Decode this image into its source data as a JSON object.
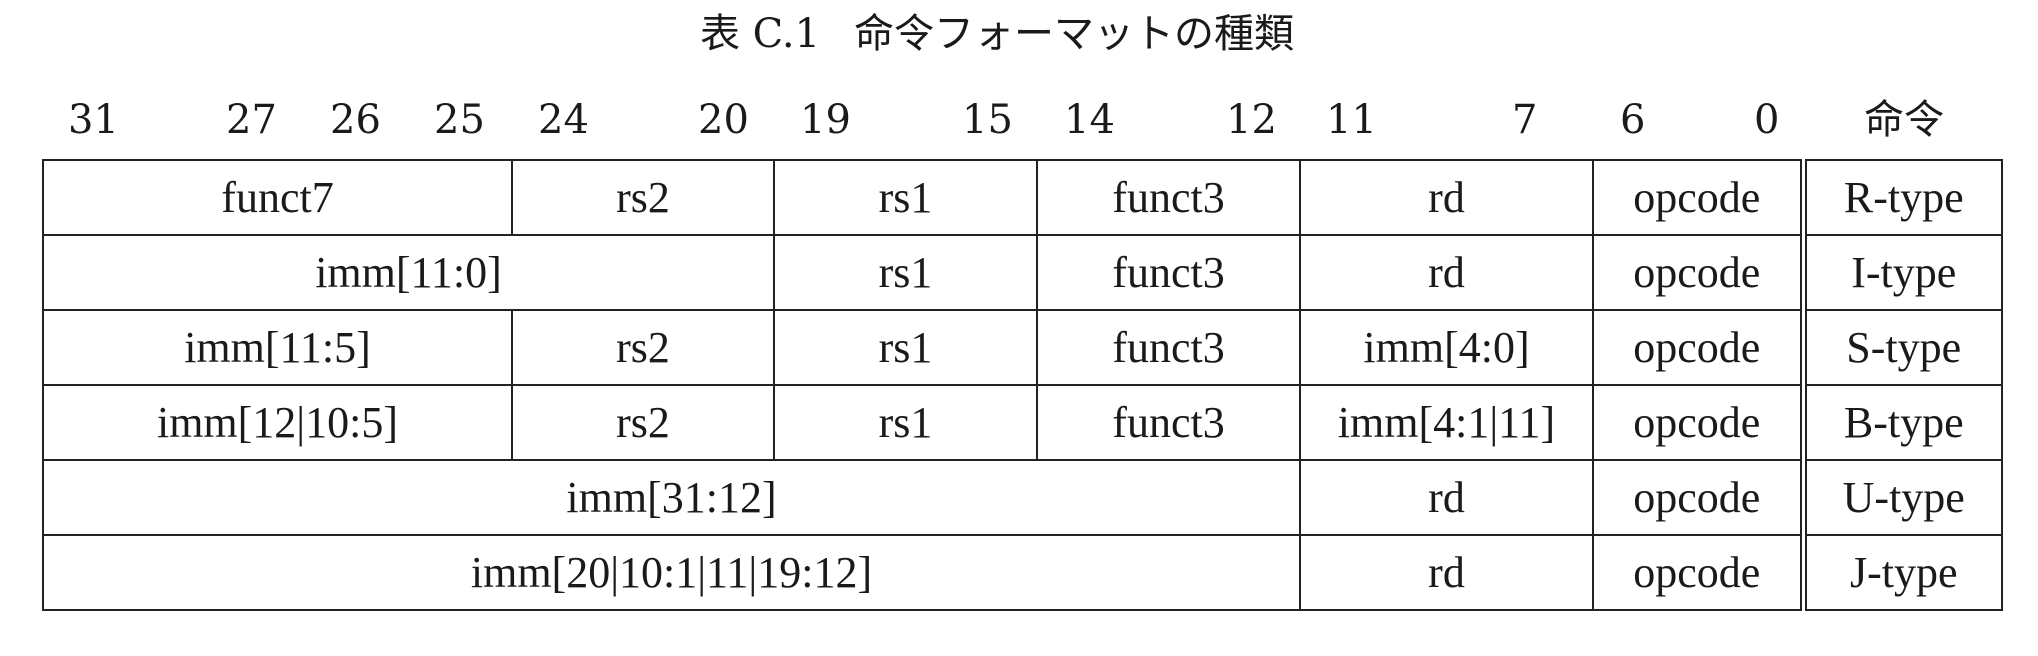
{
  "caption": {
    "number": "表 C.1",
    "title": "命令フォーマットの種類"
  },
  "bit_labels": [
    "31",
    "27",
    "26",
    "25",
    "24",
    "20",
    "19",
    "15",
    "14",
    "12",
    "11",
    "7",
    "6",
    "0"
  ],
  "type_header": "命令",
  "rows": [
    {
      "c1": "funct7",
      "c2": "rs2",
      "c3": "rs1",
      "c4": "funct3",
      "c5": "rd",
      "c6": "opcode",
      "type": "R-type"
    },
    {
      "imm": "imm[11:0]",
      "rs1": "rs1",
      "funct3": "funct3",
      "rd": "rd",
      "opcode": "opcode",
      "type": "I-type"
    },
    {
      "c1": "imm[11:5]",
      "c2": "rs2",
      "c3": "rs1",
      "c4": "funct3",
      "c5": "imm[4:0]",
      "c6": "opcode",
      "type": "S-type"
    },
    {
      "c1": "imm[12|10:5]",
      "c2": "rs2",
      "c3": "rs1",
      "c4": "funct3",
      "c5": "imm[4:1|11]",
      "c6": "opcode",
      "type": "B-type"
    },
    {
      "imm": "imm[31:12]",
      "rd": "rd",
      "opcode": "opcode",
      "type": "U-type"
    },
    {
      "imm": "imm[20|10:1|11|19:12]",
      "rd": "rd",
      "opcode": "opcode",
      "type": "J-type"
    }
  ]
}
